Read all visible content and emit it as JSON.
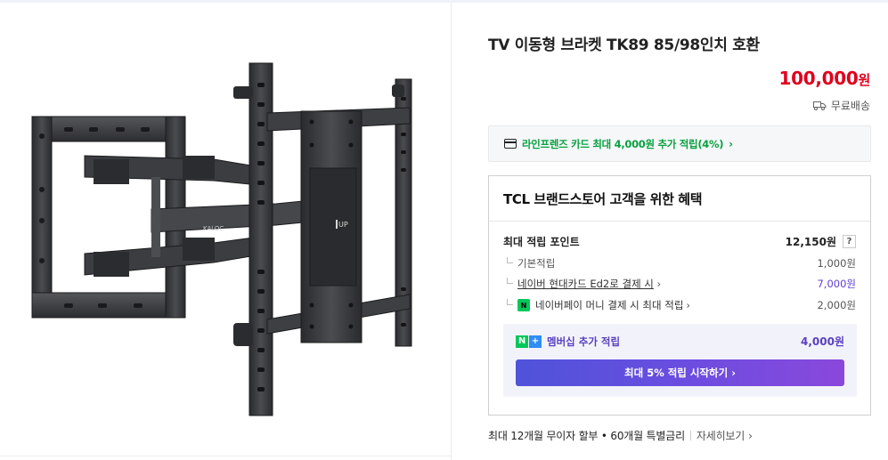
{
  "product": {
    "title": "TV 이동형 브라켓 TK89 85/98인치 호환",
    "price_number": "100,000",
    "price_unit": "원",
    "shipping": "무료배송",
    "image_text_brand": "KALOC",
    "image_text_up": "UP"
  },
  "card_banner": {
    "text": "라인프렌즈 카드 최대 4,000원 추가 적립(4%)",
    "chevron": "›",
    "accent": "#08a13f"
  },
  "benefits": {
    "title": "TCL 브랜드스토어 고객을 위한 혜택",
    "max_points_label": "최대 적립 포인트",
    "max_points_value": "12,150원",
    "help_label": "?",
    "rows": [
      {
        "label": "기본적립",
        "value": "1,000원"
      },
      {
        "label": "네이버 현대카드 Ed2로 결제 시",
        "value": "7,000원"
      },
      {
        "label": "네이버페이 머니 결제 시 최대 적립",
        "value": "2,000원"
      }
    ],
    "npay_badge": "N",
    "membership": {
      "label": "멤버십 추가 적립",
      "value": "4,000원",
      "button": "최대 5% 적립 시작하기",
      "button_chevron": "›",
      "badge_n": "N",
      "badge_plus": "+"
    }
  },
  "installment": {
    "text": "최대 12개월 무이자 할부 • 60개월 특별금리",
    "more": "자세히보기",
    "chevron": "›"
  },
  "colors": {
    "price": "#e0001d",
    "green": "#08a13f",
    "purple": "#5d3fd3"
  },
  "icons": [
    "truck-icon",
    "card-icon",
    "chevron-right-icon",
    "help-icon",
    "npay-icon",
    "naver-plus-icon"
  ]
}
